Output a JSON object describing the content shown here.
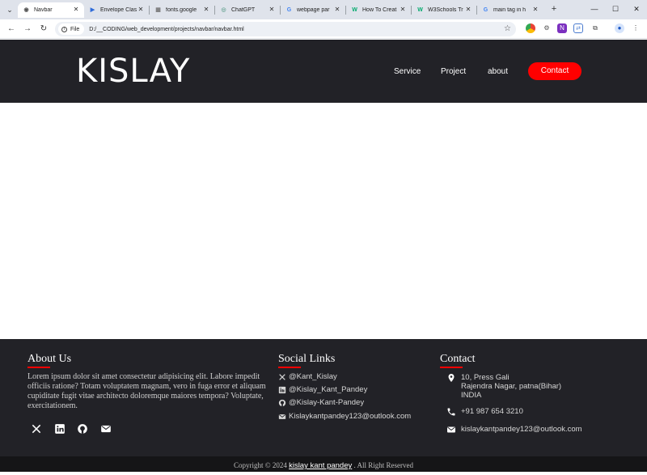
{
  "browser": {
    "tabs": [
      {
        "label": "Navbar",
        "fav_color": "#555555",
        "fav_glyph": "◉"
      },
      {
        "label": "Envelope Clas",
        "fav_color": "#2e6bd9",
        "fav_glyph": "▶"
      },
      {
        "label": "fonts.google",
        "fav_color": "#777777",
        "fav_glyph": "▦"
      },
      {
        "label": "ChatGPT",
        "fav_color": "#74aa9c",
        "fav_glyph": "◎"
      },
      {
        "label": "webpage par",
        "fav_color": "#4285f4",
        "fav_glyph": "G"
      },
      {
        "label": "How To Creat",
        "fav_color": "#04aa6d",
        "fav_glyph": "W"
      },
      {
        "label": "W3Schools Tr",
        "fav_color": "#04aa6d",
        "fav_glyph": "W"
      },
      {
        "label": "main tag in h",
        "fav_color": "#4285f4",
        "fav_glyph": "G"
      }
    ],
    "omnibox_chip": "File",
    "url": "D:/__CODING/web_development/projects/navbar/navbar.html"
  },
  "header": {
    "logo": "KISLAY",
    "nav": [
      "Service",
      "Project",
      "about"
    ],
    "cta": "Contact",
    "accent": "#ff0000",
    "bg": "#222227"
  },
  "footer": {
    "about": {
      "title": "About Us",
      "text": "Lorem ipsum dolor sit amet consectetur adipisicing elit. Labore impedit officiis ratione? Totam voluptatem magnam, vero in fuga error et aliquam cupiditate fugit vitae architecto doloremque maiores tempora? Voluptate, exercitationem.",
      "icons": [
        "x-icon",
        "linkedin-icon",
        "github-icon",
        "mail-icon"
      ]
    },
    "social": {
      "title": "Social Links",
      "items": [
        {
          "icon": "x-icon",
          "text": "@Kant_Kislay"
        },
        {
          "icon": "linkedin-icon",
          "text": "@Kislay_Kant_Pandey"
        },
        {
          "icon": "github-icon",
          "text": "@Kislay-Kant-Pandey"
        },
        {
          "icon": "mail-icon",
          "text": "Kislaykantpandey123@outlook.com"
        }
      ]
    },
    "contact": {
      "title": "Contact",
      "address": [
        "10, Press Gali",
        "Rajendra Nagar, patna(Bihar)",
        "INDIA"
      ],
      "phone": "+91 987 654 3210",
      "email": "kislaykantpandey123@outlook.com"
    },
    "copyright": {
      "prefix": "Copyright © 2024 ",
      "name": "kislay kant pandey",
      "suffix": " . All Right Reserved"
    }
  }
}
